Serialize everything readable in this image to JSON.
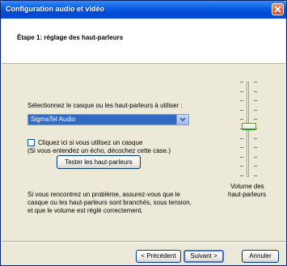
{
  "window": {
    "title": "Configuration audio et vidéo"
  },
  "header": {
    "title": "Étape 1: réglage des haut-parleurs"
  },
  "speaker_select": {
    "label": "Sélectionnez le casque ou les haut-parleurs à utiliser :",
    "value": "SigmaTel Audio"
  },
  "headset_checkbox": {
    "label": "Cliquez ici si vous utilisez un casque",
    "note": "(Si vous entendez un écho, décochez cette case.)",
    "checked": false
  },
  "test_button": {
    "label": "Tester les haut-parleurs"
  },
  "help_text": {
    "line1": "Si vous rencontrez un problème, assurez-vous que le",
    "line2": "casque ou les haut-parleurs sont branchés, sous tension,",
    "line3": "et que le volume est réglé correctement."
  },
  "volume": {
    "label_line1": "Volume des",
    "label_line2": "haut-parleurs",
    "level": 0.52
  },
  "footer": {
    "prev_label": "< Précédent",
    "next_label": "Suivant >",
    "cancel_label": "Annuler"
  }
}
